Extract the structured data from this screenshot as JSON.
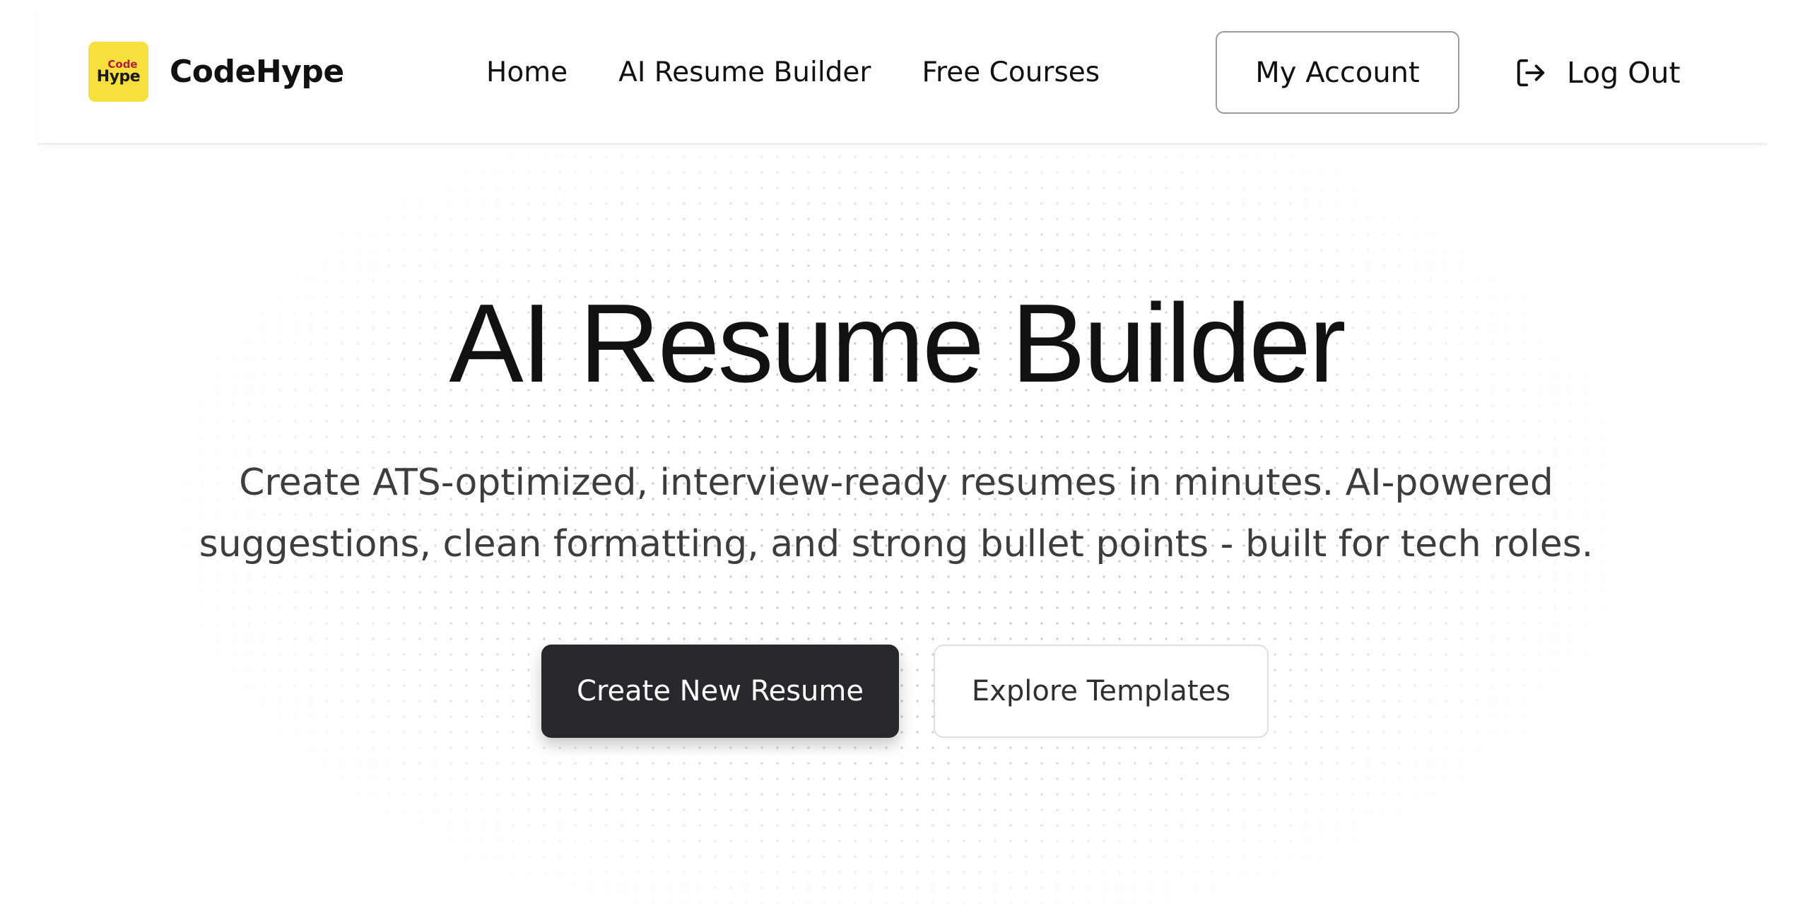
{
  "header": {
    "logo": {
      "badge_top": "Code",
      "badge_bottom": "Hype",
      "brand_name": "CodeHype",
      "badge_color": "#f7df3e"
    },
    "nav": [
      {
        "label": "Home"
      },
      {
        "label": "AI Resume Builder"
      },
      {
        "label": "Free Courses"
      }
    ],
    "account_button": "My Account",
    "logout_button": "Log Out",
    "logout_icon": "log-out-icon"
  },
  "hero": {
    "title": "AI Resume Builder",
    "subtitle": "Create ATS-optimized, interview-ready resumes in minutes. AI-powered suggestions, clean formatting, and strong bullet points - built for tech roles.",
    "primary_cta": "Create New Resume",
    "secondary_cta": "Explore Templates",
    "primary_color": "#27282b"
  }
}
